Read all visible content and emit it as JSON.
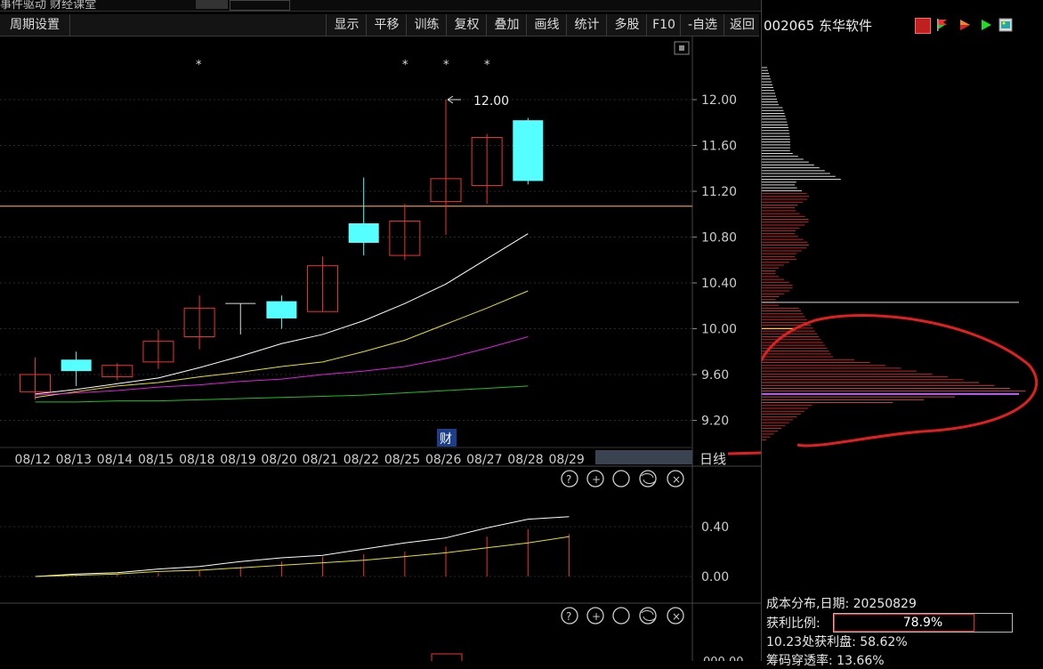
{
  "top_strip": {
    "title": "事件驱动  财经课堂",
    "badge": ""
  },
  "toolbar": {
    "period_settings": "周期设置",
    "buttons": [
      "显示",
      "平移",
      "训练",
      "复权",
      "叠加",
      "画线",
      "统计",
      "多股",
      "F10",
      "-自选",
      "返回"
    ]
  },
  "stock": {
    "code_name": "002065 东华软件"
  },
  "chart_data": {
    "type": "candlestick",
    "x_dates": [
      "08/12",
      "08/13",
      "08/14",
      "08/15",
      "08/18",
      "08/19",
      "08/20",
      "08/21",
      "08/22",
      "08/25",
      "08/26",
      "08/27",
      "08/28",
      "08/29"
    ],
    "candles": [
      {
        "date": "08/12",
        "open": 9.45,
        "close": 9.6,
        "high": 9.75,
        "low": 9.38,
        "dir": "up"
      },
      {
        "date": "08/13",
        "open": 9.73,
        "close": 9.63,
        "high": 9.8,
        "low": 9.5,
        "dir": "down"
      },
      {
        "date": "08/14",
        "open": 9.58,
        "close": 9.68,
        "high": 9.7,
        "low": 9.55,
        "dir": "up"
      },
      {
        "date": "08/15",
        "open": 9.71,
        "close": 9.89,
        "high": 9.99,
        "low": 9.65,
        "dir": "up"
      },
      {
        "date": "08/18",
        "open": 9.93,
        "close": 10.18,
        "high": 10.29,
        "low": 9.82,
        "dir": "up"
      },
      {
        "date": "08/19",
        "open": 10.22,
        "close": 10.22,
        "high": 10.22,
        "low": 9.95,
        "dir": "flat"
      },
      {
        "date": "08/20",
        "open": 10.24,
        "close": 10.09,
        "high": 10.29,
        "low": 10.0,
        "dir": "down"
      },
      {
        "date": "08/21",
        "open": 10.15,
        "close": 10.55,
        "high": 10.63,
        "low": 10.15,
        "dir": "up"
      },
      {
        "date": "08/22",
        "open": 10.92,
        "close": 10.75,
        "high": 11.32,
        "low": 10.64,
        "dir": "down"
      },
      {
        "date": "08/25",
        "open": 10.64,
        "close": 10.94,
        "high": 11.09,
        "low": 10.6,
        "dir": "up"
      },
      {
        "date": "08/26",
        "open": 11.11,
        "close": 11.31,
        "high": 12.0,
        "low": 10.82,
        "dir": "up"
      },
      {
        "date": "08/27",
        "open": 11.25,
        "close": 11.67,
        "high": 11.7,
        "low": 11.09,
        "dir": "up"
      },
      {
        "date": "08/28",
        "open": 11.82,
        "close": 11.29,
        "high": 11.84,
        "low": 11.26,
        "dir": "down"
      }
    ],
    "ma_lines": [
      {
        "color": "#ffffff",
        "values": [
          9.43,
          9.47,
          9.52,
          9.57,
          9.66,
          9.76,
          9.87,
          9.95,
          10.07,
          10.22,
          10.39,
          10.61,
          10.83
        ]
      },
      {
        "color": "#e8e020",
        "values": [
          9.4,
          9.45,
          9.5,
          9.53,
          9.58,
          9.62,
          9.67,
          9.71,
          9.8,
          9.9,
          10.04,
          10.18,
          10.33
        ]
      },
      {
        "color": "#e020e0",
        "values": [
          9.42,
          9.44,
          9.46,
          9.49,
          9.51,
          9.54,
          9.56,
          9.6,
          9.63,
          9.67,
          9.74,
          9.83,
          9.93
        ]
      },
      {
        "color": "#20c020",
        "values": [
          9.36,
          9.36,
          9.37,
          9.37,
          9.38,
          9.39,
          9.4,
          9.41,
          9.42,
          9.44,
          9.46,
          9.48,
          9.5
        ]
      }
    ],
    "h_line": 11.07,
    "max_label": "12.00",
    "y_ticks": [
      "12.00",
      "11.60",
      "11.20",
      "10.80",
      "10.40",
      "10.00",
      "9.60",
      "9.20"
    ],
    "y_tick_values": [
      12.0,
      11.6,
      11.2,
      10.8,
      10.4,
      10.0,
      9.6,
      9.2
    ],
    "event_label": "财",
    "period_label": "日线",
    "sub_chart": {
      "y_ticks": [
        "0.40",
        "0.00"
      ],
      "white_line": [
        0.0,
        0.02,
        0.03,
        0.06,
        0.08,
        0.12,
        0.15,
        0.17,
        0.22,
        0.27,
        0.31,
        0.39,
        0.46,
        0.48
      ],
      "yellow_line": [
        0.0,
        0.01,
        0.02,
        0.04,
        0.05,
        0.07,
        0.09,
        0.11,
        0.13,
        0.16,
        0.19,
        0.23,
        0.27,
        0.32
      ],
      "bars": [
        0.0,
        0.01,
        0.02,
        0.03,
        0.05,
        0.08,
        0.12,
        0.16,
        0.18,
        0.2,
        0.24,
        0.32,
        0.38,
        0.34
      ]
    },
    "bottom_sub_label": "000.00"
  },
  "cost_distribution": {
    "title": "成本分布,日期: 20250829",
    "profit_ratio_label": "获利比例:",
    "profit_ratio_value": "78.9%",
    "profit_ratio": 0.789,
    "profit_at": "10.23处获利盘: 58.62%",
    "concentration": "筹码穿透率: 13.66%"
  },
  "colors": {
    "up": "#ee3333",
    "down": "#55ffff",
    "annot": "#e02020",
    "hline": "#e0903a"
  },
  "icons": [
    "help-icon",
    "zoom-in-icon",
    "settings-icon",
    "refresh-icon",
    "close-icon"
  ]
}
